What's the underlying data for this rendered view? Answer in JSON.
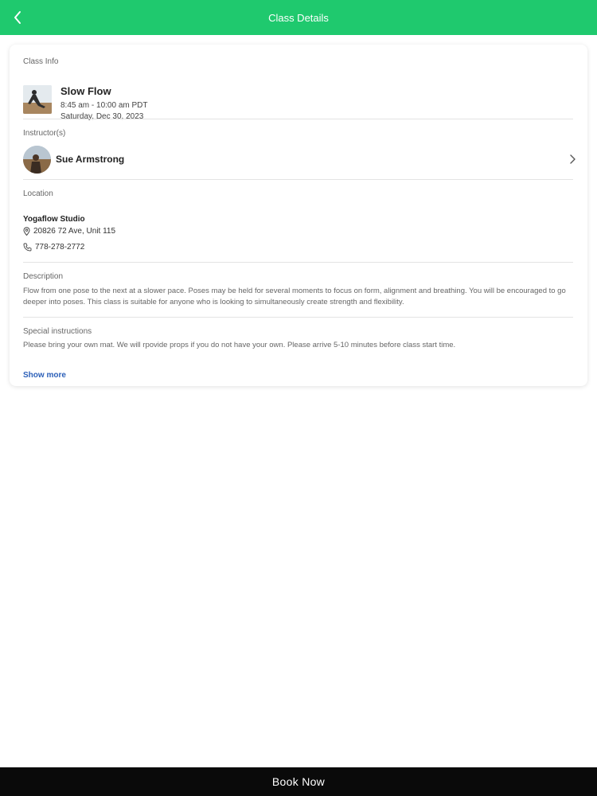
{
  "header": {
    "title": "Class Details",
    "back_icon": "chevron-left-icon",
    "bg_color": "#1fc96e"
  },
  "class_info": {
    "label": "Class Info",
    "name": "Slow Flow",
    "time": "8:45 am - 10:00 am PDT",
    "date": "Saturday, Dec 30, 2023"
  },
  "instructor": {
    "label": "Instructor(s)",
    "name": "Sue Armstrong"
  },
  "location": {
    "label": "Location",
    "studio": "Yogaflow Studio",
    "address": "20826 72 Ave, Unit 115",
    "phone": "778-278-2772"
  },
  "description": {
    "label": "Description",
    "text": "Flow from one pose to the next at a slower pace. Poses may be held for several moments to focus on form, alignment and breathing. You will be encouraged to go deeper into poses. This class is suitable for anyone who is looking to simultaneously create strength and flexibility."
  },
  "special_instructions": {
    "label": "Special instructions",
    "text": "Please bring your own mat. We will rpovide props if you do not have your own. Please arrive 5-10 minutes before class start time.",
    "show_more": "Show more"
  },
  "footer": {
    "book_label": "Book Now",
    "bg_color": "#0a0a0a"
  },
  "colors": {
    "accent": "#1fc96e",
    "link": "#2b5fb8"
  }
}
